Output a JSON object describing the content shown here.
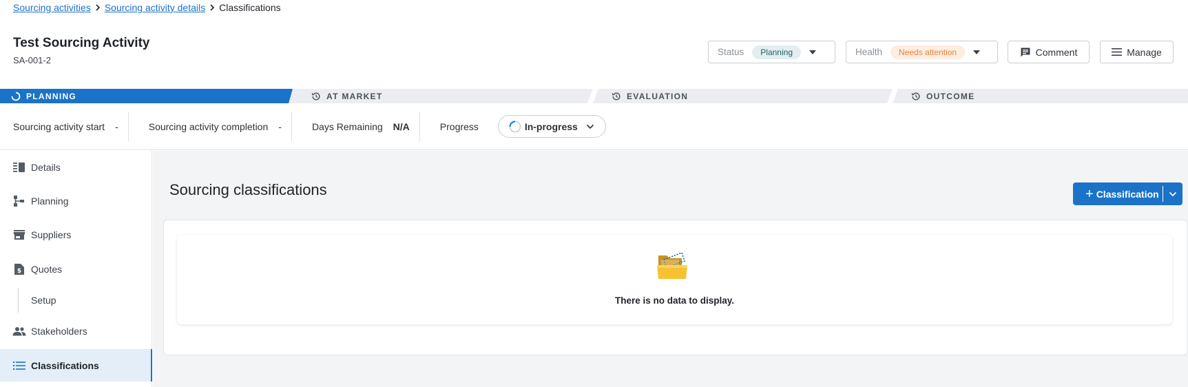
{
  "breadcrumb": {
    "items": [
      "Sourcing activities",
      "Sourcing activity details"
    ],
    "current": "Classifications"
  },
  "header": {
    "title": "Test Sourcing Activity",
    "subtitle": "SA-001-2",
    "status_label": "Status",
    "status_value": "Planning",
    "health_label": "Health",
    "health_value": "Needs attention",
    "comment_label": "Comment",
    "manage_label": "Manage"
  },
  "phases": [
    {
      "label": "PLANNING",
      "icon": "spinner-icon",
      "active": true
    },
    {
      "label": "AT MARKET",
      "icon": "history-icon",
      "active": false
    },
    {
      "label": "EVALUATION",
      "icon": "history-icon",
      "active": false
    },
    {
      "label": "OUTCOME",
      "icon": "history-icon",
      "active": false
    }
  ],
  "info": {
    "start_label": "Sourcing activity start",
    "start_value": "-",
    "completion_label": "Sourcing activity completion",
    "completion_value": "-",
    "days_label": "Days Remaining",
    "days_value": "N/A",
    "progress_label": "Progress",
    "progress_value": "In-progress"
  },
  "sidebar": {
    "items": [
      {
        "label": "Details",
        "icon": "details-icon"
      },
      {
        "label": "Planning",
        "icon": "planning-icon"
      },
      {
        "label": "Suppliers",
        "icon": "store-icon"
      },
      {
        "label": "Quotes",
        "icon": "quote-document-icon"
      },
      {
        "label": "Setup",
        "icon": ""
      },
      {
        "label": "Stakeholders",
        "icon": "people-icon"
      },
      {
        "label": "Classifications",
        "icon": "list-icon",
        "active": true
      }
    ]
  },
  "main": {
    "section_title": "Sourcing classifications",
    "add_button_label": "Classification",
    "empty_message": "There is no data to display."
  },
  "colors": {
    "accent": "#1a73c8",
    "status_pill_bg": "#e3eef0",
    "health_pill_text": "#e8823a"
  }
}
